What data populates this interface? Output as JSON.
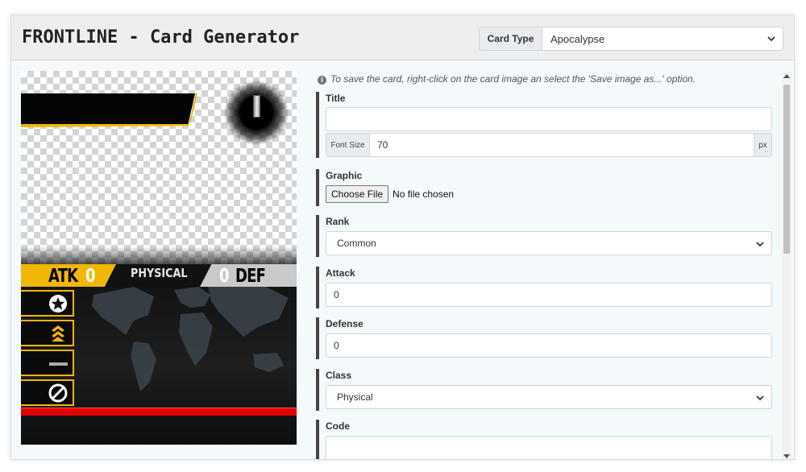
{
  "header": {
    "title": "FRONTLINE - Card Generator",
    "card_type_label": "Card Type",
    "card_type_value": "Apocalypse"
  },
  "card_preview": {
    "atk_label": "ATK",
    "atk_value": "0",
    "class_label": "PHYSICAL",
    "def_value": "0",
    "def_label": "DEF",
    "accent_color": "#f2b705",
    "stripe_color": "#e00000",
    "slot_icons": [
      "star-badge-icon",
      "chevron-rank-icon",
      "dash-icon",
      "prohibited-icon"
    ]
  },
  "form": {
    "info_text": "To save the card, right-click on the card image an select the 'Save image as...' option.",
    "title": {
      "label": "Title",
      "value": ""
    },
    "font_size": {
      "prefix": "Font Size",
      "value": "70",
      "suffix": "px"
    },
    "graphic": {
      "label": "Graphic",
      "button": "Choose File",
      "status": "No file chosen"
    },
    "rank": {
      "label": "Rank",
      "value": "Common"
    },
    "attack": {
      "label": "Attack",
      "value": "0"
    },
    "defense": {
      "label": "Defense",
      "value": "0"
    },
    "class": {
      "label": "Class",
      "value": "Physical"
    },
    "code": {
      "label": "Code",
      "value": ""
    }
  }
}
